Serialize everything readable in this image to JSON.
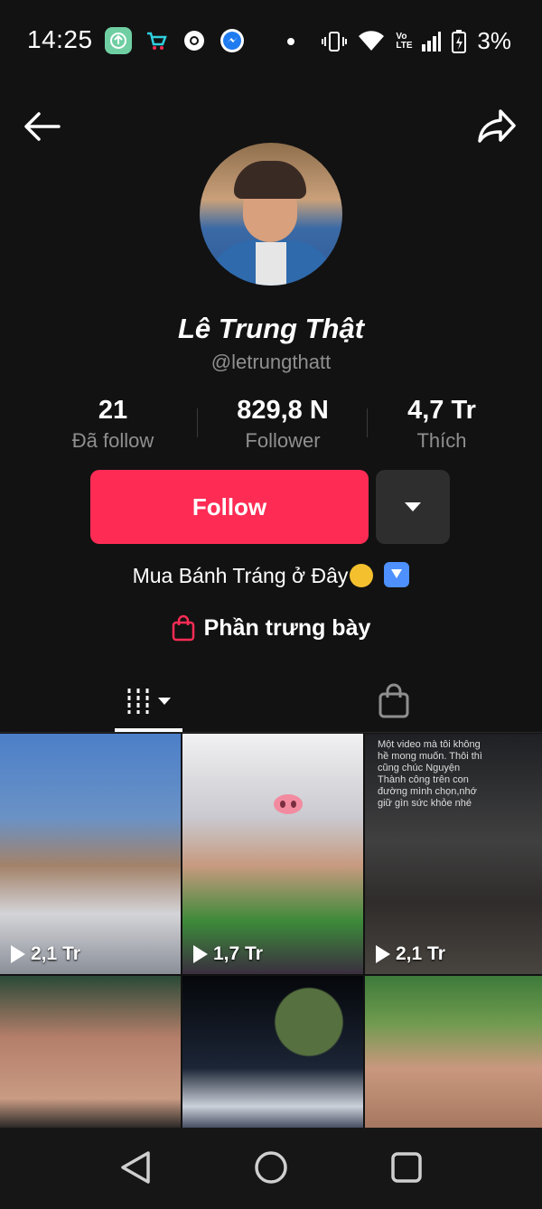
{
  "status_bar": {
    "time": "14:25",
    "battery": "3%",
    "network": "Vo LTE"
  },
  "profile": {
    "display_name": "Lê Trung Thật",
    "username": "@letrungthatt",
    "stats": [
      {
        "value": "21",
        "label": "Đã follow"
      },
      {
        "value": "829,8 N",
        "label": "Follower"
      },
      {
        "value": "4,7 Tr",
        "label": "Thích"
      }
    ],
    "follow_label": "Follow",
    "bio": "Mua Bánh Tráng ở Đây",
    "showcase_label": "Phần trưng bày"
  },
  "videos": [
    {
      "views": "2,1 Tr"
    },
    {
      "views": "1,7 Tr"
    },
    {
      "views": "2,1 Tr",
      "caption": "Một video mà tôi không hề mong muốn. Thôi thì cũng chúc Nguyện Thành công trên con đường mình chọn,nhớ giữ gìn sức khỏe nhé"
    },
    {
      "views": ""
    },
    {
      "views": ""
    },
    {
      "views": ""
    }
  ],
  "colors": {
    "accent": "#fe2c55",
    "background": "#121212",
    "secondary_text": "#8f8f8f"
  },
  "icons": {
    "back": "arrow-left-icon",
    "share": "share-arrow-icon",
    "videos_tab": "grid-bars-icon",
    "shop_tab": "shopping-bag-icon"
  }
}
